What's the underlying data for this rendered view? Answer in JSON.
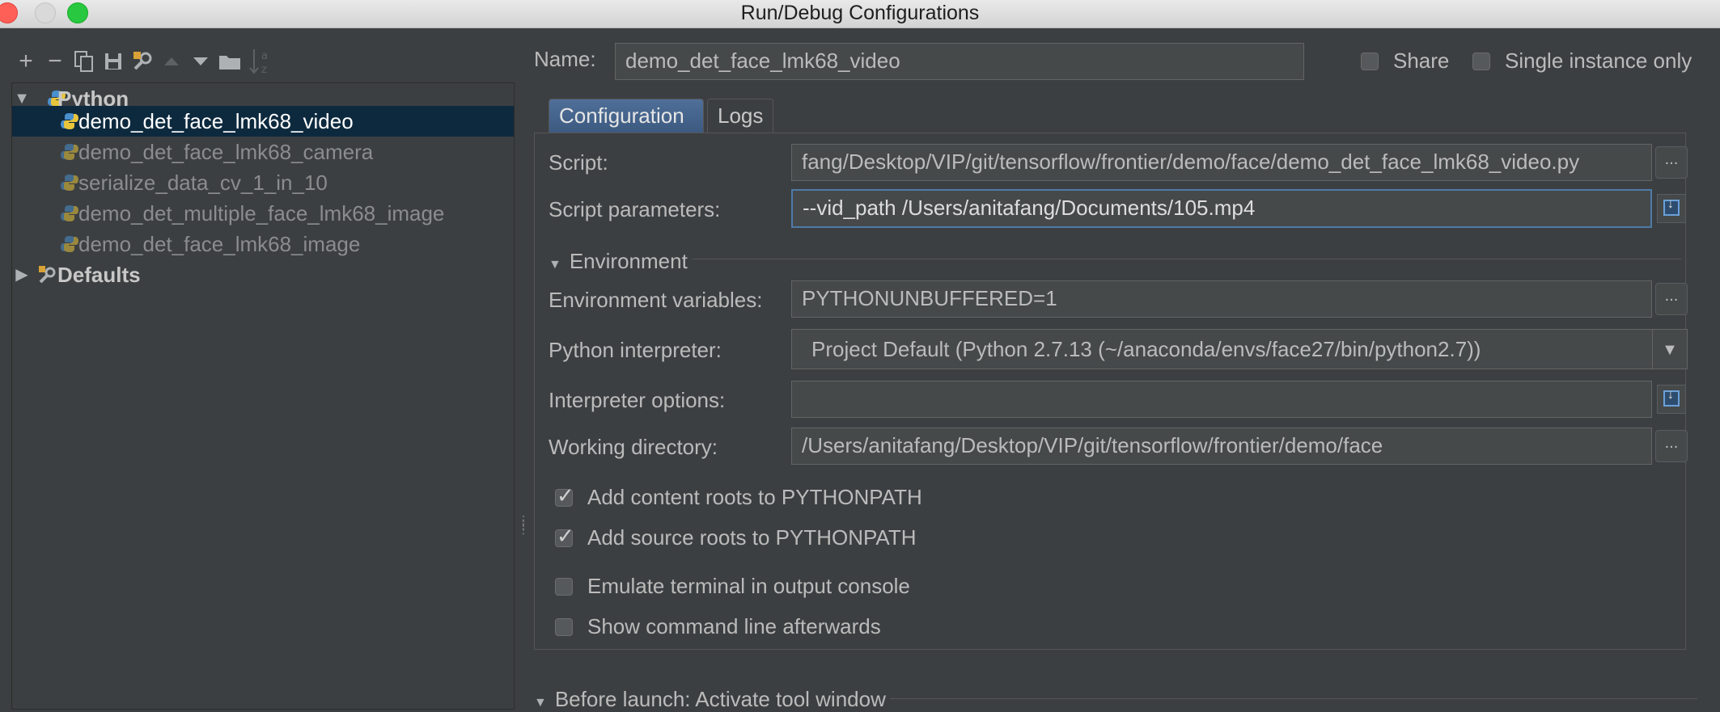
{
  "window": {
    "title": "Run/Debug Configurations"
  },
  "toolbar": {
    "add": "+",
    "remove": "−"
  },
  "tree": {
    "python_group": "Python",
    "items": [
      "demo_det_face_lmk68_video",
      "demo_det_face_lmk68_camera",
      "serialize_data_cv_1_in_10",
      "demo_det_multiple_face_lmk68_image",
      "demo_det_face_lmk68_image"
    ],
    "defaults_group": "Defaults"
  },
  "header": {
    "name_label": "Name:",
    "name_value": "demo_det_face_lmk68_video",
    "share_label": "Share",
    "single_instance_label": "Single instance only"
  },
  "tabs": {
    "configuration": "Configuration",
    "logs": "Logs"
  },
  "form": {
    "script_label": "Script:",
    "script_value": "fang/Desktop/VIP/git/tensorflow/frontier/demo/face/demo_det_face_lmk68_video.py",
    "params_label": "Script parameters:",
    "params_value": "--vid_path  /Users/anitafang/Documents/105.mp4",
    "environment_section": "Environment",
    "env_vars_label": "Environment variables:",
    "env_vars_value": "PYTHONUNBUFFERED=1",
    "interpreter_label": "Python interpreter:",
    "interpreter_value": "Project Default (Python 2.7.13 (~/anaconda/envs/face27/bin/python2.7))",
    "interp_options_label": "Interpreter options:",
    "interp_options_value": "",
    "workdir_label": "Working directory:",
    "workdir_value": "/Users/anitafang/Desktop/VIP/git/tensorflow/frontier/demo/face",
    "ellipsis": "...",
    "checkboxes": {
      "content_roots": "Add content roots to PYTHONPATH",
      "source_roots": "Add source roots to PYTHONPATH",
      "emulate_terminal": "Emulate terminal in output console",
      "show_cmdline": "Show command line afterwards"
    },
    "before_launch_section": "Before launch: Activate tool window"
  },
  "colors": {
    "background": "#3c3f41",
    "selection": "#0d293e",
    "accent": "#4b6eaf"
  }
}
